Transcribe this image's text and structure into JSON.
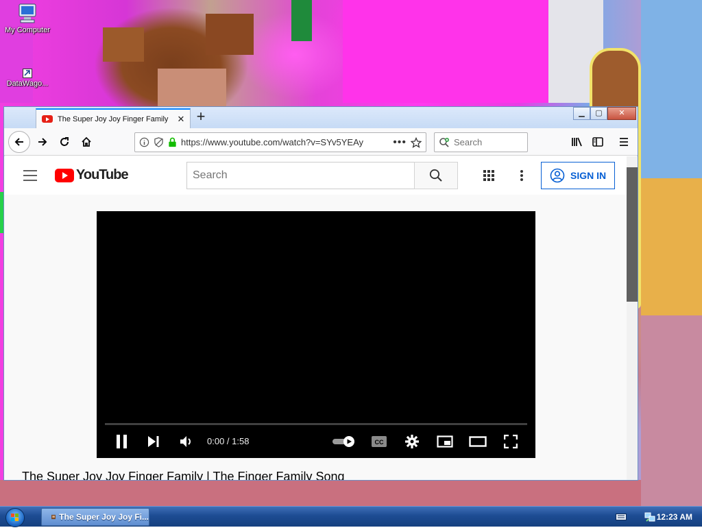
{
  "desktop": {
    "icons": [
      {
        "label": "My Computer",
        "icon": "computer-icon"
      },
      {
        "label": "DataWago...",
        "icon": "shortcut-icon"
      }
    ]
  },
  "browser": {
    "tab": {
      "title": "The Super Joy Joy Finger Family",
      "favicon": "youtube-favicon"
    },
    "address": {
      "url": "https://www.youtube.com/watch?v=SYv5YEAy"
    },
    "search": {
      "placeholder": "Search"
    },
    "window_controls": [
      "minimize",
      "maximize",
      "close"
    ]
  },
  "youtube": {
    "logo_text": "YouTube",
    "search_placeholder": "Search",
    "signin_label": "SIGN IN",
    "player": {
      "time": "0:00 / 1:58",
      "progress": 0,
      "cc_label": "CC",
      "autoplay": true
    },
    "video_title": "The Super Joy Joy Finger Family | The Finger Family Song"
  },
  "taskbar": {
    "task_label": "The Super Joy Joy Fi...",
    "clock": "12:23 AM"
  },
  "colors": {
    "youtube_red": "#ff0000",
    "signin_blue": "#065fd4",
    "firefox_blue": "#0a84ff",
    "taskbar": "#1d4c93"
  }
}
